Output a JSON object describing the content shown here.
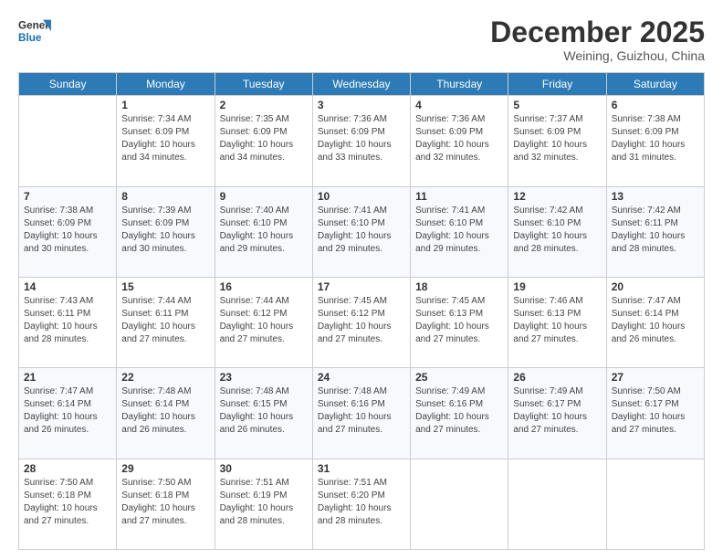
{
  "header": {
    "logo_line1": "General",
    "logo_line2": "Blue",
    "month": "December 2025",
    "location": "Weining, Guizhou, China"
  },
  "days_of_week": [
    "Sunday",
    "Monday",
    "Tuesday",
    "Wednesday",
    "Thursday",
    "Friday",
    "Saturday"
  ],
  "weeks": [
    [
      {
        "day": "",
        "info": ""
      },
      {
        "day": "1",
        "info": "Sunrise: 7:34 AM\nSunset: 6:09 PM\nDaylight: 10 hours\nand 34 minutes."
      },
      {
        "day": "2",
        "info": "Sunrise: 7:35 AM\nSunset: 6:09 PM\nDaylight: 10 hours\nand 34 minutes."
      },
      {
        "day": "3",
        "info": "Sunrise: 7:36 AM\nSunset: 6:09 PM\nDaylight: 10 hours\nand 33 minutes."
      },
      {
        "day": "4",
        "info": "Sunrise: 7:36 AM\nSunset: 6:09 PM\nDaylight: 10 hours\nand 32 minutes."
      },
      {
        "day": "5",
        "info": "Sunrise: 7:37 AM\nSunset: 6:09 PM\nDaylight: 10 hours\nand 32 minutes."
      },
      {
        "day": "6",
        "info": "Sunrise: 7:38 AM\nSunset: 6:09 PM\nDaylight: 10 hours\nand 31 minutes."
      }
    ],
    [
      {
        "day": "7",
        "info": "Sunrise: 7:38 AM\nSunset: 6:09 PM\nDaylight: 10 hours\nand 30 minutes."
      },
      {
        "day": "8",
        "info": "Sunrise: 7:39 AM\nSunset: 6:09 PM\nDaylight: 10 hours\nand 30 minutes."
      },
      {
        "day": "9",
        "info": "Sunrise: 7:40 AM\nSunset: 6:10 PM\nDaylight: 10 hours\nand 29 minutes."
      },
      {
        "day": "10",
        "info": "Sunrise: 7:41 AM\nSunset: 6:10 PM\nDaylight: 10 hours\nand 29 minutes."
      },
      {
        "day": "11",
        "info": "Sunrise: 7:41 AM\nSunset: 6:10 PM\nDaylight: 10 hours\nand 29 minutes."
      },
      {
        "day": "12",
        "info": "Sunrise: 7:42 AM\nSunset: 6:10 PM\nDaylight: 10 hours\nand 28 minutes."
      },
      {
        "day": "13",
        "info": "Sunrise: 7:42 AM\nSunset: 6:11 PM\nDaylight: 10 hours\nand 28 minutes."
      }
    ],
    [
      {
        "day": "14",
        "info": "Sunrise: 7:43 AM\nSunset: 6:11 PM\nDaylight: 10 hours\nand 28 minutes."
      },
      {
        "day": "15",
        "info": "Sunrise: 7:44 AM\nSunset: 6:11 PM\nDaylight: 10 hours\nand 27 minutes."
      },
      {
        "day": "16",
        "info": "Sunrise: 7:44 AM\nSunset: 6:12 PM\nDaylight: 10 hours\nand 27 minutes."
      },
      {
        "day": "17",
        "info": "Sunrise: 7:45 AM\nSunset: 6:12 PM\nDaylight: 10 hours\nand 27 minutes."
      },
      {
        "day": "18",
        "info": "Sunrise: 7:45 AM\nSunset: 6:13 PM\nDaylight: 10 hours\nand 27 minutes."
      },
      {
        "day": "19",
        "info": "Sunrise: 7:46 AM\nSunset: 6:13 PM\nDaylight: 10 hours\nand 27 minutes."
      },
      {
        "day": "20",
        "info": "Sunrise: 7:47 AM\nSunset: 6:14 PM\nDaylight: 10 hours\nand 26 minutes."
      }
    ],
    [
      {
        "day": "21",
        "info": "Sunrise: 7:47 AM\nSunset: 6:14 PM\nDaylight: 10 hours\nand 26 minutes."
      },
      {
        "day": "22",
        "info": "Sunrise: 7:48 AM\nSunset: 6:14 PM\nDaylight: 10 hours\nand 26 minutes."
      },
      {
        "day": "23",
        "info": "Sunrise: 7:48 AM\nSunset: 6:15 PM\nDaylight: 10 hours\nand 26 minutes."
      },
      {
        "day": "24",
        "info": "Sunrise: 7:48 AM\nSunset: 6:16 PM\nDaylight: 10 hours\nand 27 minutes."
      },
      {
        "day": "25",
        "info": "Sunrise: 7:49 AM\nSunset: 6:16 PM\nDaylight: 10 hours\nand 27 minutes."
      },
      {
        "day": "26",
        "info": "Sunrise: 7:49 AM\nSunset: 6:17 PM\nDaylight: 10 hours\nand 27 minutes."
      },
      {
        "day": "27",
        "info": "Sunrise: 7:50 AM\nSunset: 6:17 PM\nDaylight: 10 hours\nand 27 minutes."
      }
    ],
    [
      {
        "day": "28",
        "info": "Sunrise: 7:50 AM\nSunset: 6:18 PM\nDaylight: 10 hours\nand 27 minutes."
      },
      {
        "day": "29",
        "info": "Sunrise: 7:50 AM\nSunset: 6:18 PM\nDaylight: 10 hours\nand 27 minutes."
      },
      {
        "day": "30",
        "info": "Sunrise: 7:51 AM\nSunset: 6:19 PM\nDaylight: 10 hours\nand 28 minutes."
      },
      {
        "day": "31",
        "info": "Sunrise: 7:51 AM\nSunset: 6:20 PM\nDaylight: 10 hours\nand 28 minutes."
      },
      {
        "day": "",
        "info": ""
      },
      {
        "day": "",
        "info": ""
      },
      {
        "day": "",
        "info": ""
      }
    ]
  ]
}
